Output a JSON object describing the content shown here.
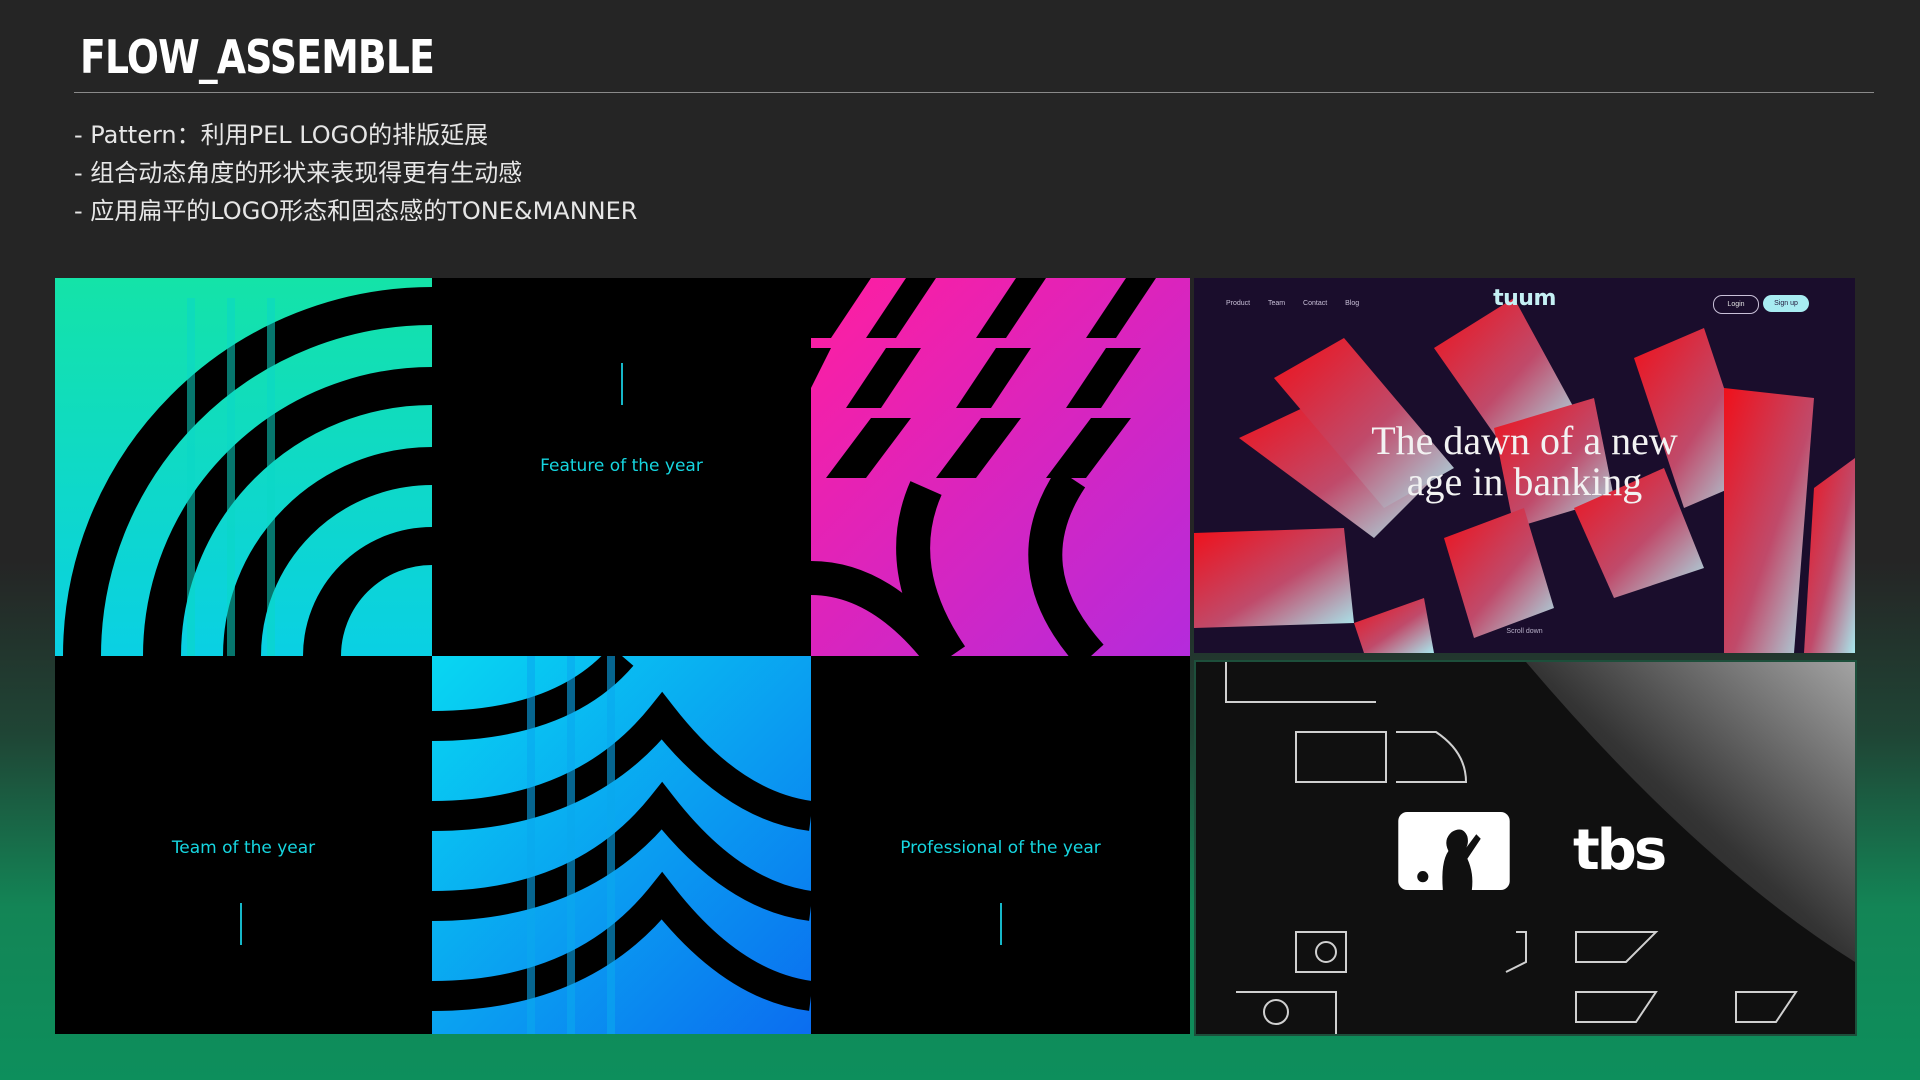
{
  "title": "FLOW_ASSEMBLE",
  "bullets": [
    "- Pattern：利用PEL LOGO的排版延展",
    "- 组合动态角度的形状来表现得更有生动感",
    "- 应用扁平的LOGO形态和固态感的TONE&MANNER"
  ],
  "tiles": {
    "feature": "Feature of the year",
    "team": "Team of the year",
    "professional": "Professional of the year"
  },
  "tuum": {
    "logo": "tuum",
    "nav": [
      "Product",
      "Team",
      "Contact",
      "Blog"
    ],
    "login": "Login",
    "signup": "Sign up",
    "headline_line1": "The dawn of a new",
    "headline_line2": "age in banking",
    "scroll": "Scroll down"
  },
  "tbs": {
    "brand": "tbs"
  },
  "colors": {
    "green_gradient": [
      "#14e3a8",
      "#0ad0e4"
    ],
    "magenta_gradient": [
      "#ff1ea0",
      "#b42bdc"
    ],
    "blue_gradient": [
      "#08d7f2",
      "#0b6df0"
    ],
    "caption": "#16d6e0",
    "tuum_red": "#f0101a"
  }
}
